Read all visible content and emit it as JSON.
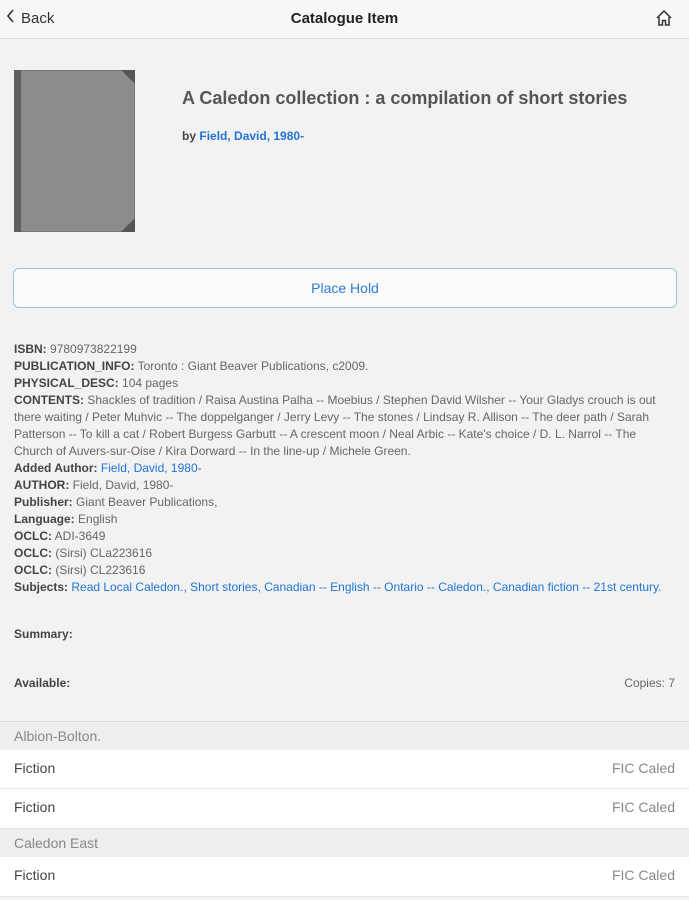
{
  "nav": {
    "back_label": "Back",
    "title": "Catalogue Item",
    "home_icon": "home-icon"
  },
  "book": {
    "title": "A Caledon collection : a compilation of short stories",
    "by_prefix": "by",
    "author_link": "Field, David, 1980-"
  },
  "hold_button": {
    "label": "Place Hold"
  },
  "details": {
    "isbn_label": "ISBN:",
    "isbn": "9780973822199",
    "pub_label": "PUBLICATION_INFO:",
    "pub": "Toronto : Giant Beaver Publications, c2009.",
    "phys_label": "PHYSICAL_DESC:",
    "phys": "104 pages",
    "contents_label": "CONTENTS:",
    "contents": "Shackles of tradition / Raisa Austina Palha -- Moebius / Stephen David Wilsher -- Your Gladys crouch is out there waiting / Peter Muhvic -- The doppelganger / Jerry Levy -- The stones / Lindsay R. Allison -- The deer path / Sarah Patterson -- To kill a cat / Robert Burgess Garbutt -- A crescent moon / Neal Arbic -- Kate's choice / D. L. Narrol -- The Church of Auvers-sur-Oise / Kira Dorward -- In the line-up / Michele Green.",
    "added_author_label": "Added Author:",
    "added_author": "Field, David, 1980-",
    "author_label": "AUTHOR:",
    "author": "Field, David, 1980-",
    "publisher_label": "Publisher:",
    "publisher": "Giant Beaver Publications,",
    "language_label": "Language:",
    "language": "English",
    "oclc_label": "OCLC:",
    "oclc1": "ADI-3649",
    "oclc2": "(Sirsi) CLa223616",
    "oclc3": "(Sirsi) CL223616",
    "subjects_label": "Subjects:",
    "subjects": "Read Local Caledon., Short stories, Canadian -- English -- Ontario -- Caledon., Canadian fiction -- 21st century."
  },
  "summary_label": "Summary:",
  "available_label": "Available:",
  "copies": "Copies: 7",
  "holdings": [
    {
      "branch": "Albion-Bolton."
    },
    {
      "collection": "Fiction",
      "call": "FIC Caled"
    },
    {
      "collection": "Fiction",
      "call": "FIC Caled"
    },
    {
      "branch": "Caledon East"
    },
    {
      "collection": "Fiction",
      "call": "FIC Caled"
    }
  ]
}
